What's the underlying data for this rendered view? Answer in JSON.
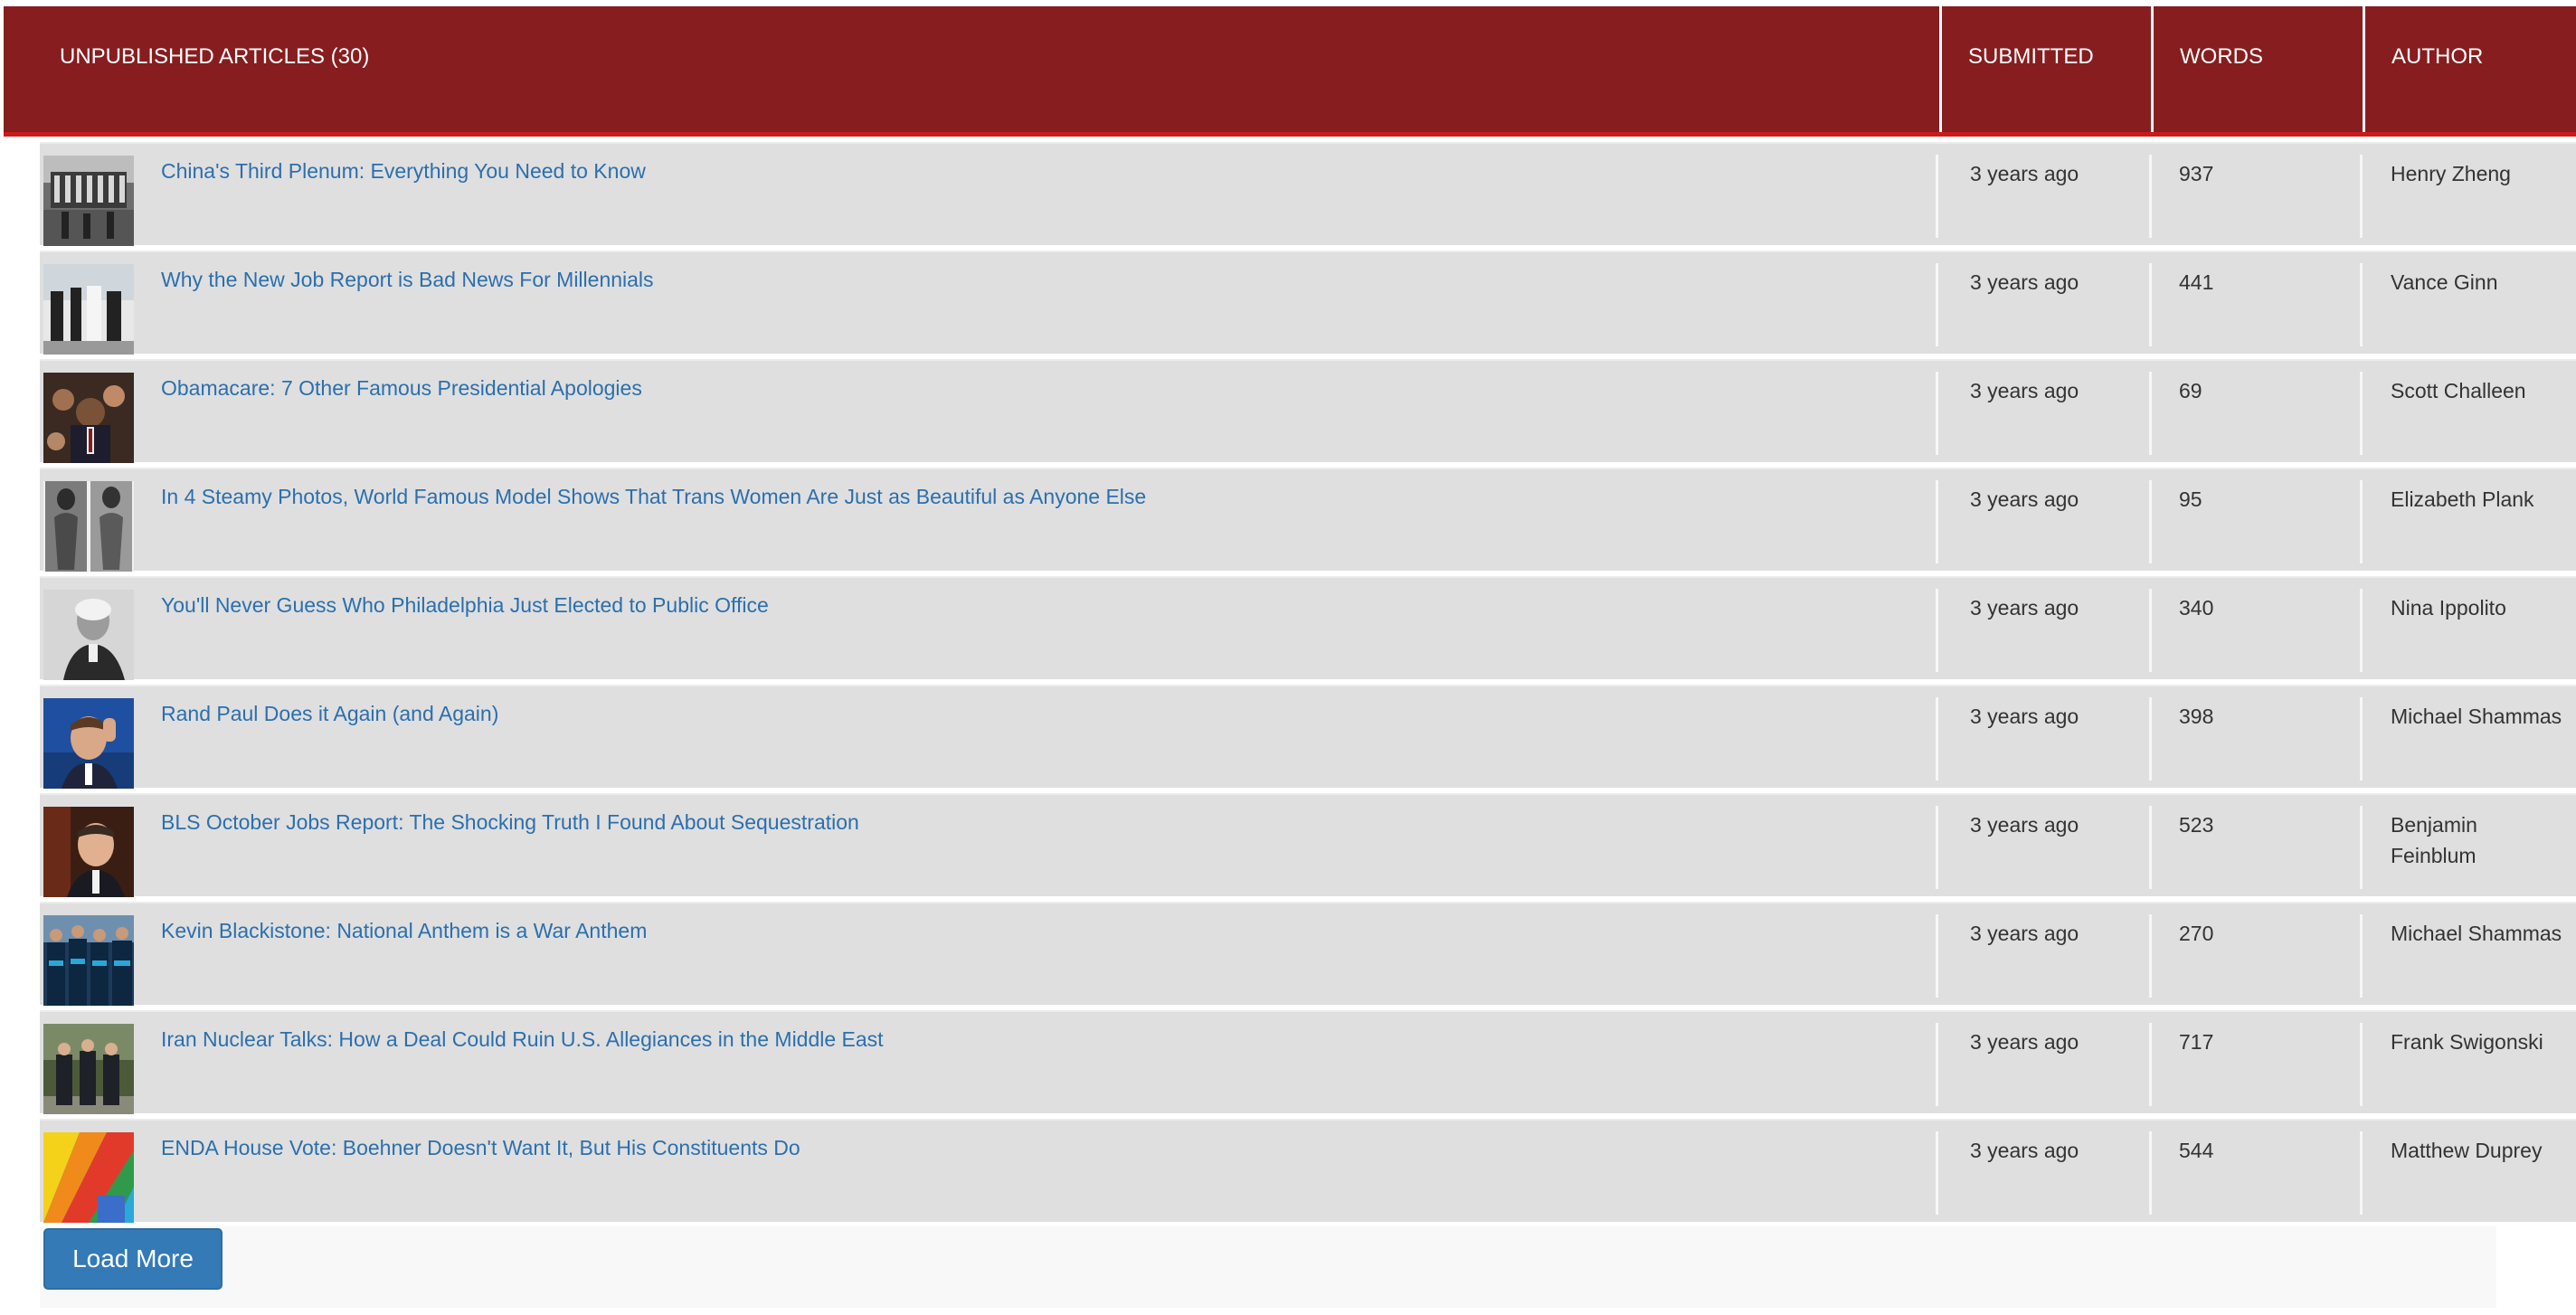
{
  "header": {
    "title": "UNPUBLISHED ARTICLES (30)",
    "submitted": "SUBMITTED",
    "words": "WORDS",
    "author": "AUTHOR"
  },
  "colors": {
    "header_bg": "#871d1f",
    "header_accent": "#cc1a1a",
    "row_bg": "#dfdfdf",
    "link": "#2b6fae",
    "button": "#337ab7"
  },
  "articles": [
    {
      "title": "China's Third Plenum: Everything You Need to Know",
      "submitted": "3 years ago",
      "words": "937",
      "author": "Henry Zheng",
      "thumb": "plenum-photo"
    },
    {
      "title": "Why the New Job Report is Bad News For Millennials",
      "submitted": "3 years ago",
      "words": "441",
      "author": "Vance Ginn",
      "thumb": "jobs-photo"
    },
    {
      "title": "Obamacare: 7 Other Famous Presidential Apologies",
      "submitted": "3 years ago",
      "words": "69",
      "author": "Scott Challeen",
      "thumb": "president-photo"
    },
    {
      "title": "In 4 Steamy Photos, World Famous Model Shows That Trans Women Are Just as Beautiful as Anyone Else",
      "submitted": "3 years ago",
      "words": "95",
      "author": "Elizabeth Plank",
      "thumb": "model-photo"
    },
    {
      "title": "You'll Never Guess Who Philadelphia Just Elected to Public Office",
      "submitted": "3 years ago",
      "words": "340",
      "author": "Nina Ippolito",
      "thumb": "portrait-photo"
    },
    {
      "title": "Rand Paul Does it Again (and Again)",
      "submitted": "3 years ago",
      "words": "398",
      "author": "Michael Shammas",
      "thumb": "senator-photo"
    },
    {
      "title": "BLS October Jobs Report: The Shocking Truth I Found About Sequestration",
      "submitted": "3 years ago",
      "words": "523",
      "author": "Benjamin Feinblum",
      "thumb": "speaker-photo"
    },
    {
      "title": "Kevin Blackistone: National Anthem is a War Anthem",
      "submitted": "3 years ago",
      "words": "270",
      "author": "Michael Shammas",
      "thumb": "team-photo"
    },
    {
      "title": "Iran Nuclear Talks: How a Deal Could Ruin U.S. Allegiances in the Middle East",
      "submitted": "3 years ago",
      "words": "717",
      "author": "Frank Swigonski",
      "thumb": "diplomats-photo"
    },
    {
      "title": "ENDA House Vote: Boehner Doesn't Want It, But His Constituents Do",
      "submitted": "3 years ago",
      "words": "544",
      "author": "Matthew Duprey",
      "thumb": "rainbow-photo"
    }
  ],
  "load_more": "Load More"
}
